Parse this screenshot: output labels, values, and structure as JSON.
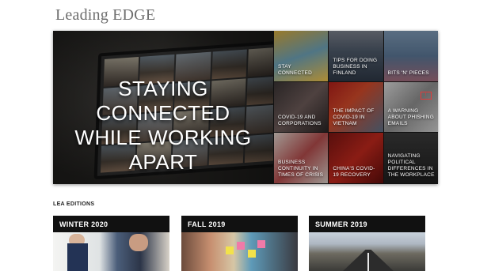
{
  "header": {
    "logo": "Leading EDGE"
  },
  "feature": {
    "title_lines": [
      "STAYING",
      "CONNECTED",
      "WHILE WORKING",
      "APART"
    ]
  },
  "tiles": [
    {
      "label": "STAY CONNECTED"
    },
    {
      "label": "TIPS FOR DOING BUSINESS IN FINLAND"
    },
    {
      "label": "BITS 'N' PIECES"
    },
    {
      "label": "COVID-19 AND CORPORATIONS"
    },
    {
      "label": "THE IMPACT OF COVID-19 IN VIETNAM"
    },
    {
      "label": "A WARNING ABOUT PHISHING EMAILS"
    },
    {
      "label": "BUSINESS CONTINUITY IN TIMES OF CRISIS"
    },
    {
      "label": "CHINA'S COVID-19 RECOVERY"
    },
    {
      "label": "NAVIGATING POLITICAL DIFFERENCES IN THE WORKPLACE"
    }
  ],
  "editions_section": {
    "label": "LEA EDITIONS"
  },
  "editions": [
    {
      "title": "WINTER 2020"
    },
    {
      "title": "FALL 2019"
    },
    {
      "title": "SUMMER 2019"
    }
  ]
}
